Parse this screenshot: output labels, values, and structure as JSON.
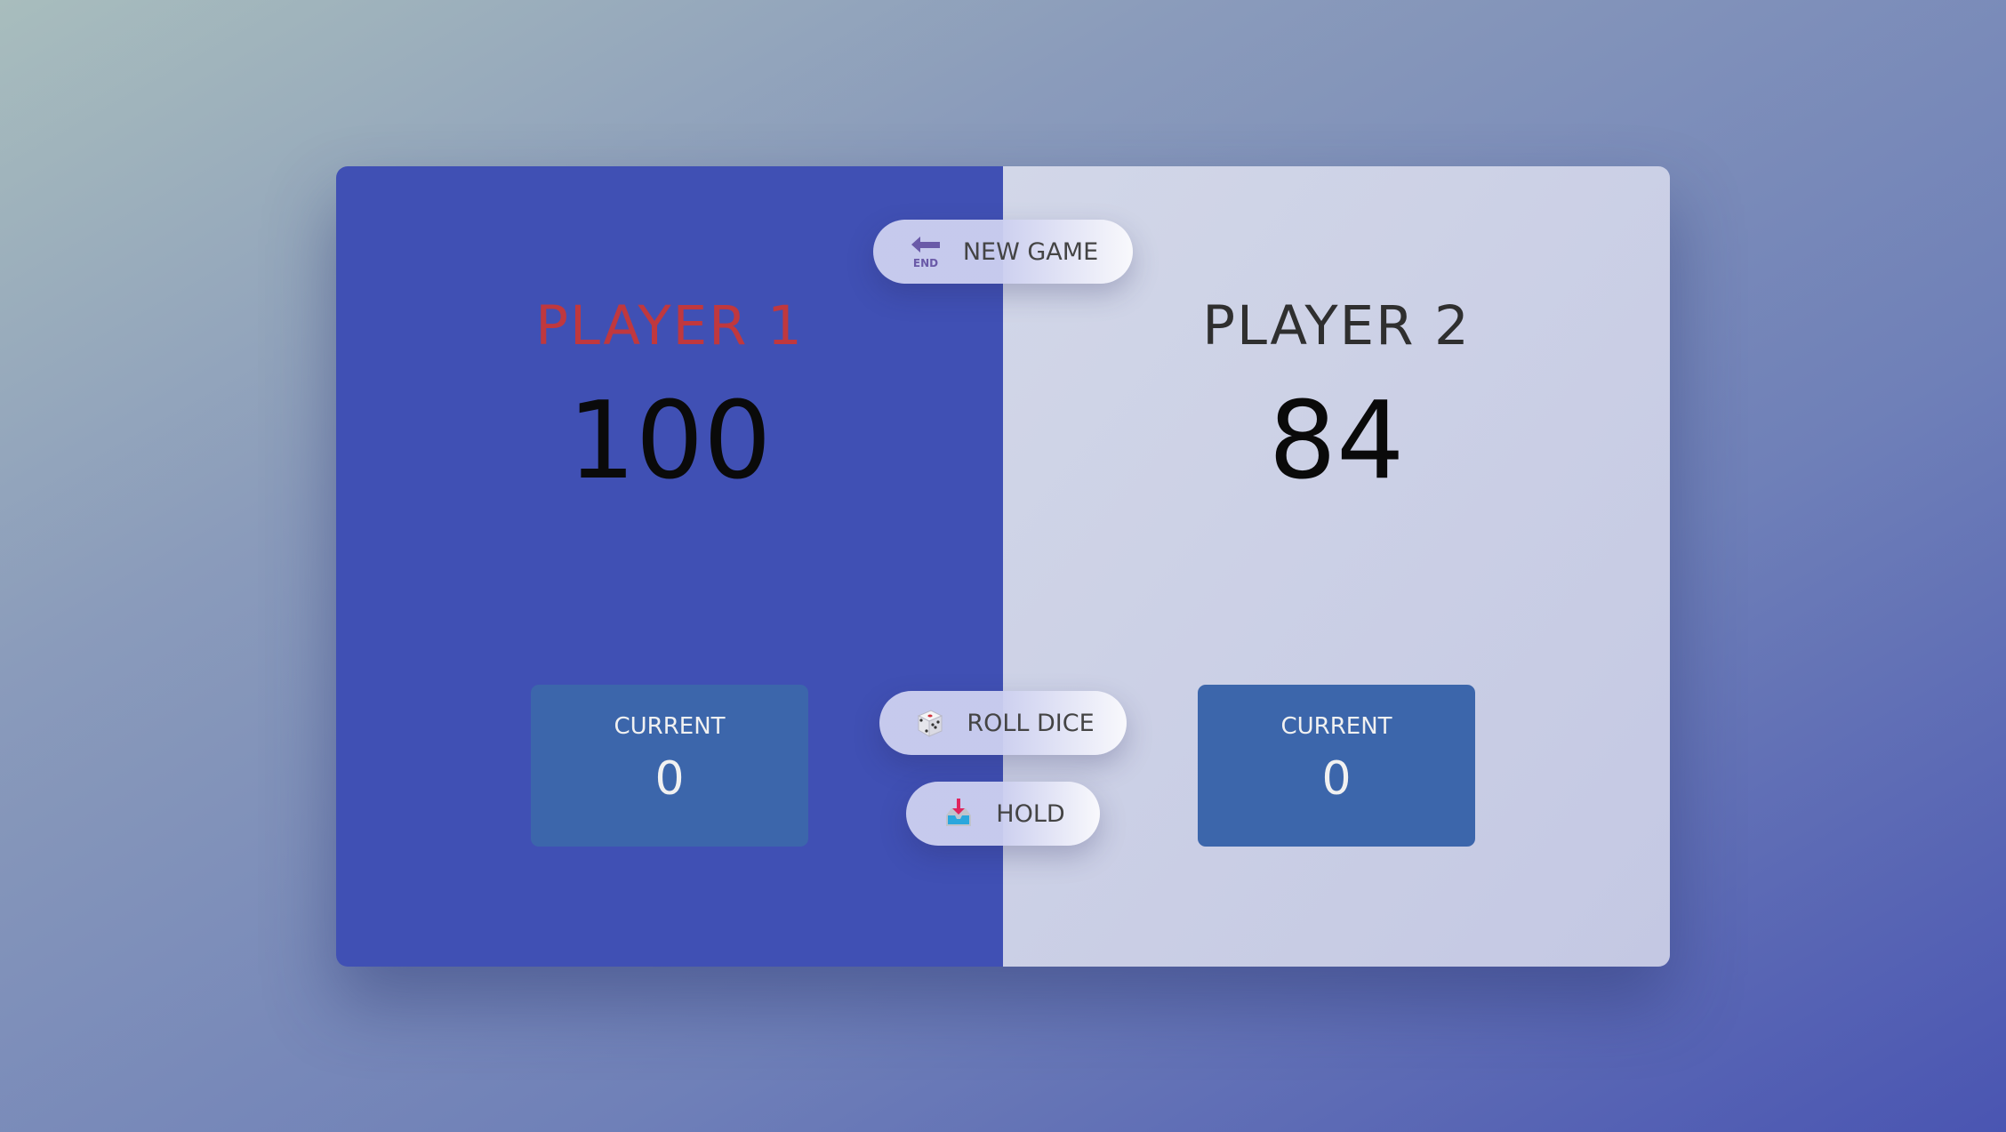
{
  "buttons": {
    "new_game": {
      "label": "NEW GAME",
      "icon": "end-arrow-icon",
      "icon_text": "END"
    },
    "roll_dice": {
      "label": "ROLL DICE",
      "icon": "dice-icon"
    },
    "hold": {
      "label": "HOLD",
      "icon": "inbox-tray-icon"
    }
  },
  "players": [
    {
      "name": "PLAYER 1",
      "score": "100",
      "current_label": "CURRENT",
      "current_score": "0",
      "active": true
    },
    {
      "name": "PLAYER 2",
      "score": "84",
      "current_label": "CURRENT",
      "current_score": "0",
      "active": false
    }
  ],
  "colors": {
    "player1_panel": "#4050b4",
    "player2_panel": "#cdd1e6",
    "current_box": "#3c66ab",
    "active_name": "#c0383e",
    "inactive_name": "#2f2f2f"
  }
}
